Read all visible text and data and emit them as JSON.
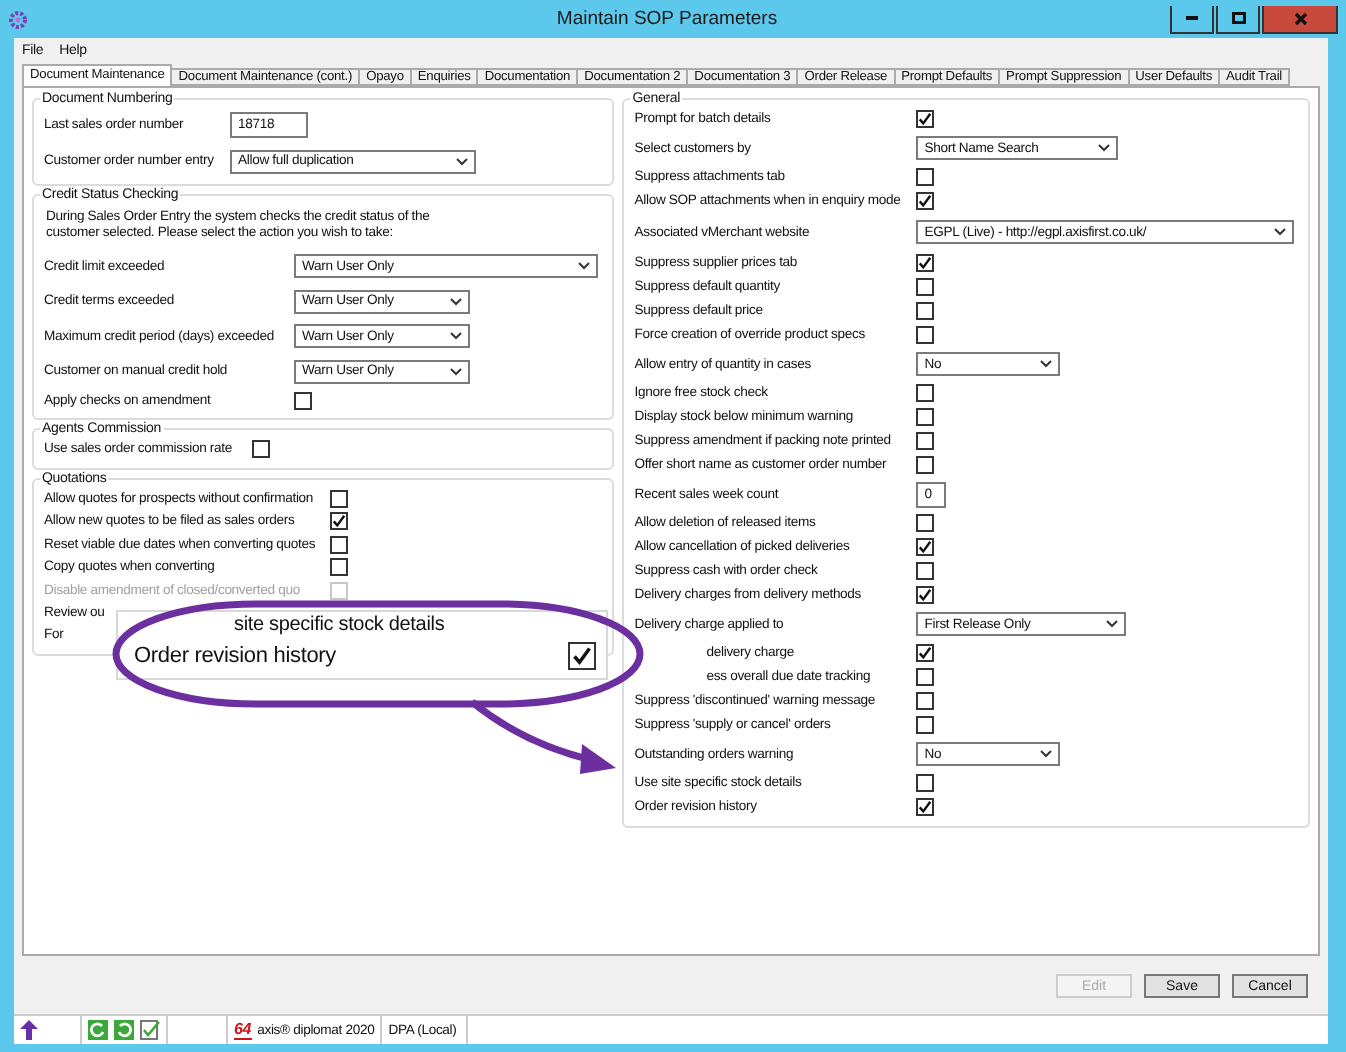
{
  "window": {
    "title": "Maintain SOP Parameters"
  },
  "menu": [
    "File",
    "Help"
  ],
  "tabs": [
    {
      "label": "Document Maintenance",
      "selected": true
    },
    {
      "label": "Document Maintenance (cont.)",
      "selected": false
    },
    {
      "label": "Opayo",
      "selected": false
    },
    {
      "label": "Enquiries",
      "selected": false
    },
    {
      "label": "Documentation",
      "selected": false
    },
    {
      "label": "Documentation 2",
      "selected": false
    },
    {
      "label": "Documentation 3",
      "selected": false
    },
    {
      "label": "Order Release",
      "selected": false
    },
    {
      "label": "Prompt Defaults",
      "selected": false
    },
    {
      "label": "Prompt Suppression",
      "selected": false
    },
    {
      "label": "User Defaults",
      "selected": false
    },
    {
      "label": "Audit Trail",
      "selected": false
    }
  ],
  "left_groups": [
    {
      "title": "Document Numbering",
      "rows": [
        {
          "kind": "number",
          "label": "Last sales order number",
          "value": "18718"
        },
        {
          "kind": "dropdown",
          "label": "Customer order number entry",
          "value": "Allow full duplication"
        }
      ]
    },
    {
      "title": "Credit Status Checking",
      "intro": "During Sales Order Entry the system checks the credit status of the customer selected. Please select the action you wish to take:",
      "rows": [
        {
          "kind": "combobox",
          "label": "Credit limit exceeded",
          "value": "Warn User Only"
        },
        {
          "kind": "dropdown",
          "label": "Credit terms exceeded",
          "value": "Warn User Only"
        },
        {
          "kind": "dropdown",
          "label": "Maximum credit period (days) exceeded",
          "value": "Warn User Only"
        },
        {
          "kind": "dropdown",
          "label": "Customer on manual credit hold",
          "value": "Warn User Only"
        },
        {
          "kind": "checkbox",
          "label": "Apply checks on amendment",
          "checked": false
        }
      ]
    },
    {
      "title": "Agents Commission",
      "rows": [
        {
          "kind": "inline",
          "label": "Use sales order commission rate",
          "checked": false
        }
      ]
    },
    {
      "title": "Quotations",
      "rows": [
        {
          "kind": "checkbox",
          "label": "Allow quotes for prospects without confirmation",
          "checked": false,
          "disabled": false
        },
        {
          "kind": "checkbox",
          "label": "Allow new quotes to be filed as sales orders",
          "checked": true,
          "disabled": false
        },
        {
          "kind": "checkbox",
          "label": "Reset viable due dates when converting quotes",
          "checked": false,
          "disabled": false
        },
        {
          "kind": "checkbox",
          "label": "Copy quotes when converting",
          "checked": false,
          "disabled": false
        },
        {
          "kind": "checkbox",
          "label": "Disable amendment of closed/converted quo",
          "checked": false,
          "disabled": true
        },
        {
          "kind": "covered",
          "label": "Review ou"
        },
        {
          "kind": "covered",
          "label": "For"
        }
      ]
    }
  ],
  "general": {
    "title": "General",
    "rows": [
      {
        "kind": "checkbox",
        "label": "Prompt for batch details",
        "checked": true
      },
      {
        "kind": "dropdown",
        "label": "Select customers by",
        "value": "Short Name Search"
      },
      {
        "kind": "checkbox",
        "label": "Suppress attachments tab",
        "checked": false
      },
      {
        "kind": "checkbox",
        "label": "Allow SOP attachments when in enquiry mode",
        "checked": true
      },
      {
        "kind": "combobox",
        "label": "Associated vMerchant website",
        "value": "EGPL (Live) - http://egpl.axisfirst.co.uk/"
      },
      {
        "kind": "checkbox",
        "label": "Suppress supplier prices tab",
        "checked": true
      },
      {
        "kind": "checkbox",
        "label": "Suppress default quantity",
        "checked": false
      },
      {
        "kind": "checkbox",
        "label": "Suppress default price",
        "checked": false
      },
      {
        "kind": "checkbox",
        "label": "Force creation of override product specs",
        "checked": false
      },
      {
        "kind": "dropdown",
        "label": "Allow entry of quantity in cases",
        "value": "No"
      },
      {
        "kind": "checkbox",
        "label": "Ignore free stock check",
        "checked": false
      },
      {
        "kind": "checkbox",
        "label": "Display stock below minimum warning",
        "checked": false
      },
      {
        "kind": "checkbox",
        "label": "Suppress amendment if packing note printed",
        "checked": false
      },
      {
        "kind": "checkbox",
        "label": "Offer short name as customer order number",
        "checked": false
      },
      {
        "kind": "number",
        "label": "Recent sales week count",
        "value": "0"
      },
      {
        "kind": "checkbox",
        "label": "Allow deletion of released items",
        "checked": false
      },
      {
        "kind": "checkbox",
        "label": "Allow cancellation of picked deliveries",
        "checked": true
      },
      {
        "kind": "checkbox",
        "label": "Suppress cash with order check",
        "checked": false
      },
      {
        "kind": "checkbox",
        "label": "Delivery charges from delivery methods",
        "checked": true
      },
      {
        "kind": "dropdown",
        "label": "Delivery charge applied to",
        "value": "First Release Only"
      },
      {
        "kind": "tail",
        "label": "delivery charge",
        "checked": true
      },
      {
        "kind": "tail",
        "label": "ess overall due date tracking",
        "checked": false
      },
      {
        "kind": "checkbox",
        "label": "Suppress 'discontinued' warning message",
        "checked": false
      },
      {
        "kind": "checkbox",
        "label": "Suppress 'supply or cancel' orders",
        "checked": false
      },
      {
        "kind": "dropdown",
        "label": "Outstanding orders warning",
        "value": "No"
      },
      {
        "kind": "checkbox",
        "label": "Use site specific stock details",
        "checked": false
      },
      {
        "kind": "checkbox",
        "label": "Order revision history",
        "checked": true
      }
    ]
  },
  "callout": {
    "caption": "site specific stock details",
    "label": "Order revision history",
    "checked": true
  },
  "buttons": [
    {
      "label": "Edit",
      "disabled": true
    },
    {
      "label": "Save",
      "disabled": false
    },
    {
      "label": "Cancel",
      "disabled": false
    }
  ],
  "status_bar": {
    "logo": "64",
    "product": "axis® diplomat 2020",
    "connection": "DPA (Local)"
  }
}
